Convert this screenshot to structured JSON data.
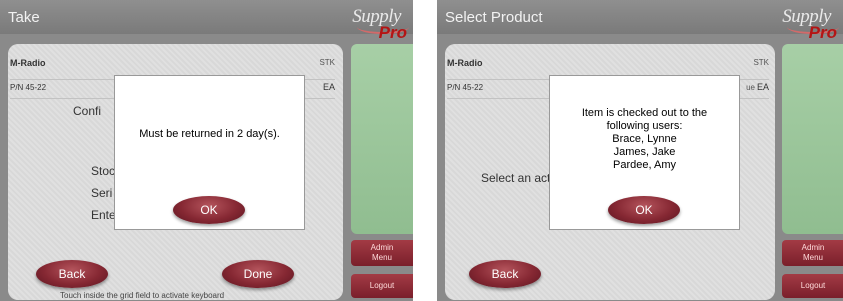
{
  "left": {
    "title": "Take",
    "logo": {
      "line1": "Supply",
      "line2": "Pro"
    },
    "item_name": "M-Radio",
    "item_code": "STK",
    "part_number": "P/N  45-22",
    "unit": "EA",
    "bg_text": {
      "confirm": "Confi",
      "stock": "Stoc",
      "serial": "Seri",
      "enter": "Ente"
    },
    "dialog": {
      "message": "Must be returned in 2 day(s).",
      "ok_label": "OK"
    },
    "back_label": "Back",
    "done_label": "Done",
    "side": {
      "admin_label": "Admin\nMenu",
      "logout_label": "Logout"
    },
    "hint": "Touch inside the grid field to activate keyboard"
  },
  "right": {
    "title": "Select Product",
    "logo": {
      "line1": "Supply",
      "line2": "Pro"
    },
    "item_name": "M-Radio",
    "item_code": "STK",
    "part_number": "P/N  45-22",
    "unit_suffix": "ue",
    "unit": "EA",
    "bg_text": {
      "select_action": "Select an actio"
    },
    "dialog": {
      "lines": [
        "Item is checked out to the",
        "following users:",
        "Brace, Lynne",
        "James, Jake",
        "Pardee, Amy"
      ],
      "ok_label": "OK"
    },
    "back_label": "Back",
    "side": {
      "admin_label": "Admin\nMenu",
      "logout_label": "Logout"
    }
  }
}
